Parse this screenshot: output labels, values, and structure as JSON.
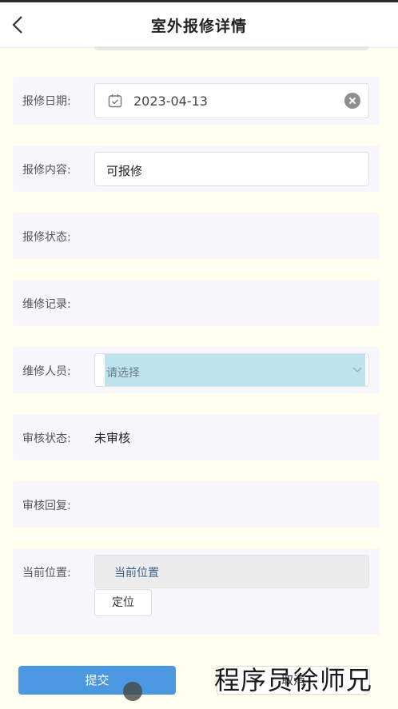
{
  "header": {
    "title": "室外报修详情",
    "back_icon": "chevron-left-icon"
  },
  "form": {
    "repair_date": {
      "label": "报修日期:",
      "value": "2023-04-13",
      "icon": "calendar-icon",
      "clear_icon": "clear-circle-icon"
    },
    "repair_content": {
      "label": "报修内容:",
      "value": "可报修"
    },
    "repair_status": {
      "label": "报修状态:",
      "value": ""
    },
    "maintenance_record": {
      "label": "维修记录:",
      "value": ""
    },
    "maintenance_staff": {
      "label": "维修人员:",
      "placeholder": "请选择",
      "icon": "chevron-down-icon"
    },
    "review_status": {
      "label": "审核状态:",
      "value": "未审核"
    },
    "review_reply": {
      "label": "审核回复:",
      "value": ""
    },
    "current_location": {
      "label": "当前位置:",
      "value": "当前位置",
      "locate_label": "定位"
    }
  },
  "actions": {
    "submit_label": "提交",
    "cancel_label": "取消"
  },
  "watermark": "程序员徐师兄",
  "colors": {
    "page_bg": "#fffff0",
    "row_bg": "#f7f6fb",
    "primary": "#4c98e0",
    "select_highlight": "#bde3ee"
  }
}
